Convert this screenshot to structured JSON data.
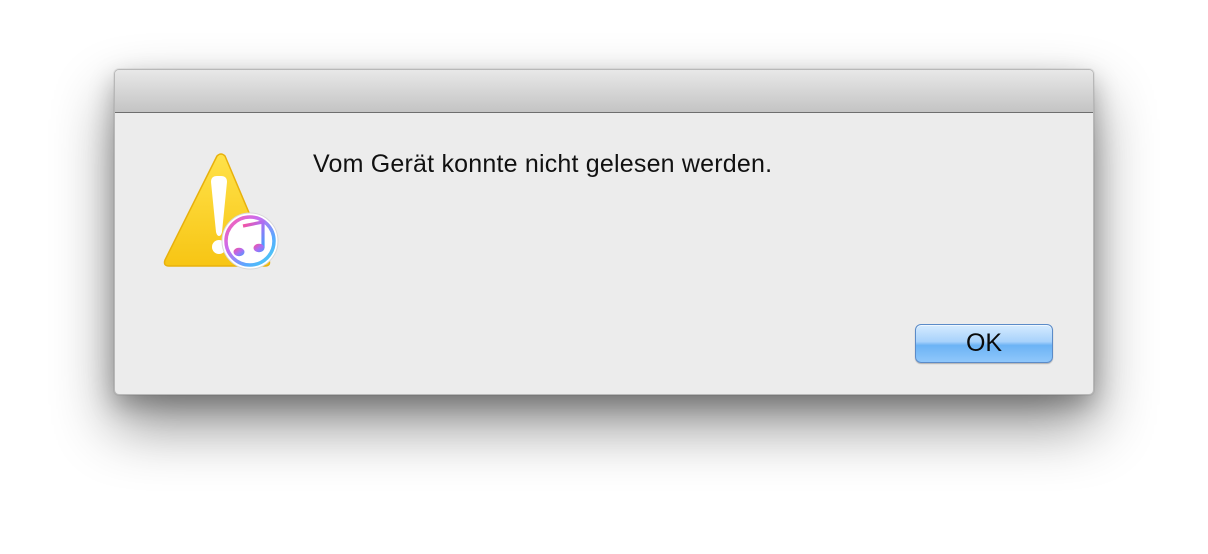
{
  "dialog": {
    "message": "Vom Gerät konnte nicht gelesen werden.",
    "icon": "warning-itunes-icon",
    "ok_label": "OK"
  },
  "colors": {
    "dialog_background": "#ececec",
    "button_accent": "#6cb3f5",
    "warning_yellow": "#ffd21f"
  }
}
